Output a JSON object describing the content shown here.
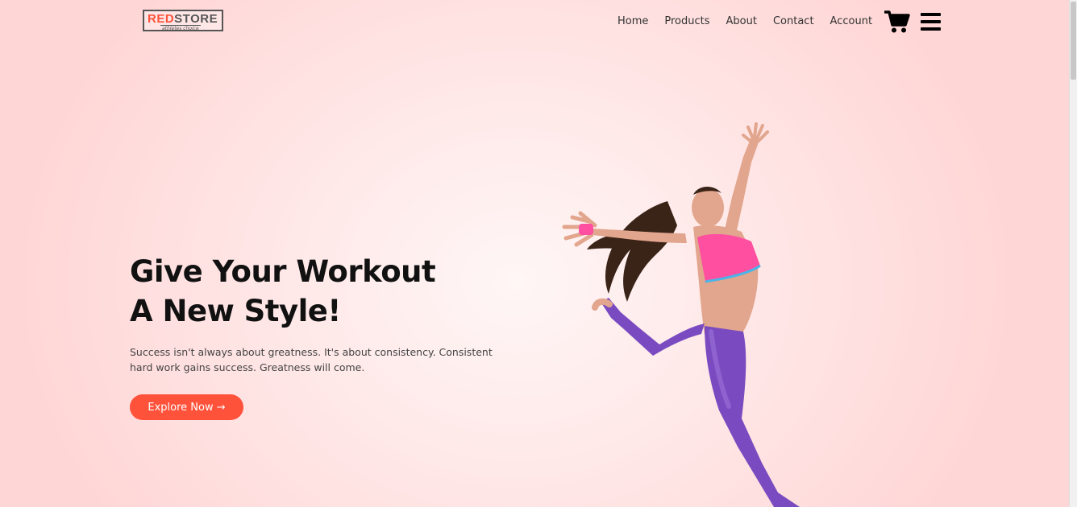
{
  "brand": {
    "name_red": "RED",
    "name_dark": "STORE",
    "tagline": "athletes choice",
    "accent_color": "#ff523b"
  },
  "nav": {
    "links": [
      {
        "label": "Home"
      },
      {
        "label": "Products"
      },
      {
        "label": "About"
      },
      {
        "label": "Contact"
      },
      {
        "label": "Account"
      }
    ],
    "cart_icon": "shopping-cart-icon",
    "menu_icon": "hamburger-menu-icon"
  },
  "hero": {
    "title_line1": "Give Your Workout",
    "title_line2": "A New Style!",
    "description": "Success isn't always about greatness. It's about consistency. Consistent hard work gains success. Greatness will come.",
    "cta_label": "Explore Now →",
    "image": "woman-jumping-in-workout-outfit"
  },
  "colors": {
    "background": "#ffe2e2",
    "button": "#ff523b",
    "top_color": "#ff4fa0",
    "pants_color": "#7a4bc0"
  }
}
